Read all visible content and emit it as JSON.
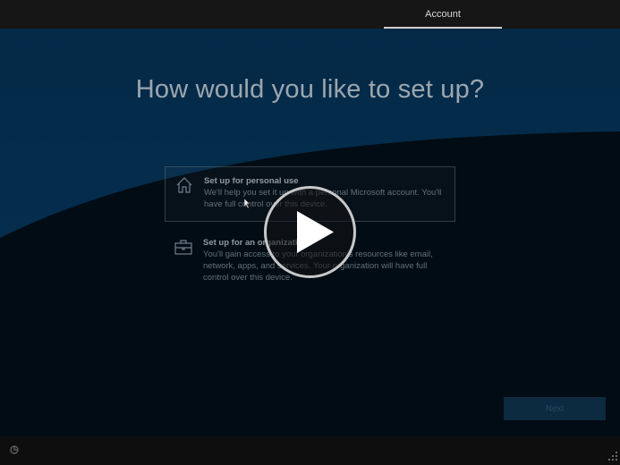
{
  "topbar": {
    "active_tab": "Account"
  },
  "page": {
    "title": "How would you like to set up?"
  },
  "options": [
    {
      "heading": "Set up for personal use",
      "description": "We'll help you set it up with a personal Microsoft account. You'll have full control over this device.",
      "icon": "home-icon",
      "selected": true
    },
    {
      "heading": "Set up for an organization",
      "description": "You'll gain access to your organization's resources like email, network, apps, and services. Your organization will have full control over this device.",
      "icon": "briefcase-icon",
      "selected": false
    }
  ],
  "footer": {
    "next_label": "Next"
  },
  "colors": {
    "background_top": "#063a63",
    "wave": "#03111d",
    "topbar": "#161616"
  },
  "overlay": {
    "type": "video-play-button"
  }
}
